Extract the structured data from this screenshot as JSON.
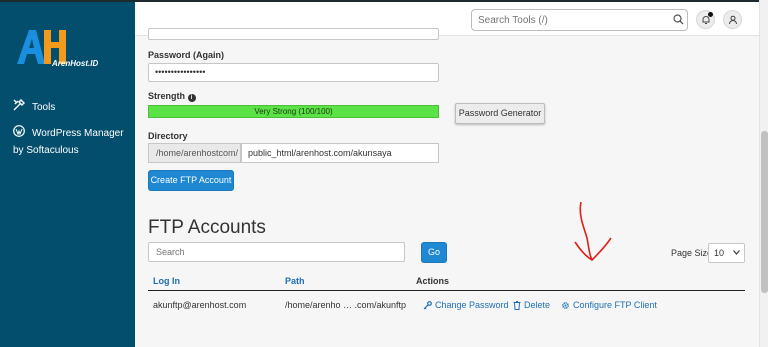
{
  "sidebar": {
    "brand": "ArenHost.ID",
    "items": [
      {
        "label": "Tools",
        "icon": "tools-icon"
      },
      {
        "label": "WordPress Manager",
        "label2": "by Softaculous",
        "icon": "wordpress-icon"
      }
    ],
    "bg_color": "#034e6c"
  },
  "topbar": {
    "search_placeholder": "Search Tools (/)"
  },
  "form": {
    "password_again_label": "Password (Again)",
    "password_again_value": "••••••••••••••••",
    "strength_label": "Strength",
    "strength_text": "Very Strong (100/100)",
    "strength_level": 100,
    "password_generator_label": "Password Generator",
    "directory_label": "Directory",
    "directory_prefix": "/home/arenhostcom/",
    "directory_value": "public_html/arenhost.com/akunsaya",
    "create_button_label": "Create FTP Account"
  },
  "accounts": {
    "title": "FTP Accounts",
    "search_placeholder": "Search",
    "go_label": "Go",
    "page_size_label": "Page Size",
    "page_size_value": "10",
    "columns": [
      "Log In",
      "Path",
      "Actions"
    ],
    "rows": [
      {
        "login": "akunftp@arenhost.com",
        "path": "/home/arenho … .com/akunftp",
        "actions": [
          "Change Password",
          "Delete",
          "Configure FTP Client"
        ]
      }
    ]
  },
  "colors": {
    "accent": "#1e88d3",
    "link": "#1e6fb8",
    "strength": "#5be246",
    "annotation": "#e0201b"
  }
}
